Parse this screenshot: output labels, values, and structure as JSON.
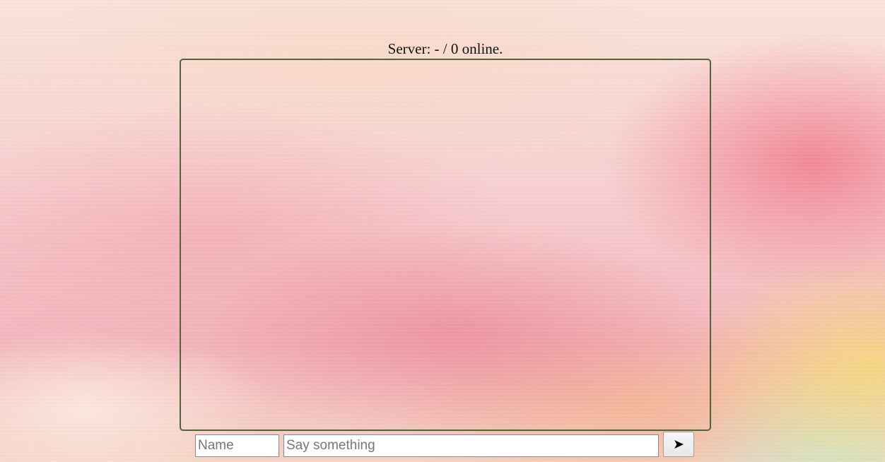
{
  "header": {
    "status_text": "Server: - / 0 online."
  },
  "chat": {
    "messages": []
  },
  "composer": {
    "name_placeholder": "Name",
    "name_value": "",
    "message_placeholder": "Say something",
    "message_value": "",
    "send_icon": "send-arrow-icon",
    "send_glyph": "➤"
  },
  "colors": {
    "chat_border": "#4f6437"
  }
}
